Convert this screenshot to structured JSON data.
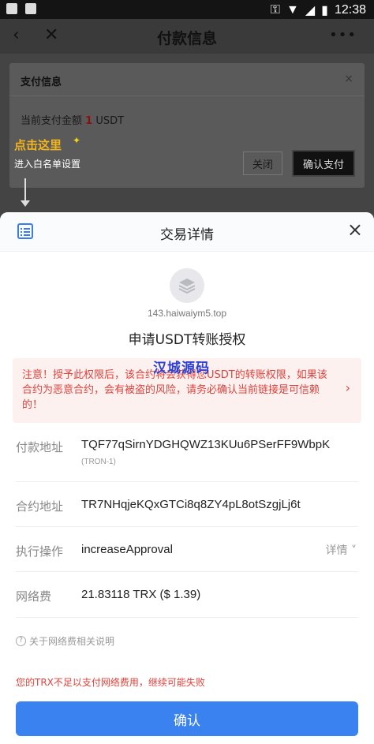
{
  "status_bar": {
    "time": "12:38"
  },
  "app_header": {
    "title": "付款信息",
    "back_icon": "back-arrow-icon",
    "close_icon": "close-icon",
    "more": "•••"
  },
  "pay_dialog": {
    "title": "支付信息",
    "close_glyph": "×",
    "amount_prefix": "当前支付金额 ",
    "amount_value": "1",
    "amount_unit": " USDT",
    "btn_close": "关闭",
    "btn_confirm": "确认支付"
  },
  "hint": {
    "click_here": "点击这里",
    "subtitle": "进入白名单设置"
  },
  "sheet": {
    "title": "交易详情",
    "close_glyph": "×",
    "domain": "143.haiwaiym5.top",
    "auth_title": "申请USDT转账授权",
    "warning": "注意！授予此权限后，该合约将会获得您USDT的转账权限，如果该合约为恶意合约，会有被盗的风险，请务必确认当前链接是可信赖的！",
    "watermark": "汉城源码",
    "rows": [
      {
        "label": "付款地址",
        "value": "TQF77qSirnYDGHQWZ13KUu6PSerFF9WbpK",
        "sub": "(TRON-1)"
      },
      {
        "label": "合约地址",
        "value": "TR7NHqjeKQxGTCi8q8ZY4pL8otSzgjLj6t"
      },
      {
        "label": "执行操作",
        "value": "increaseApproval",
        "detail": "详情 ˅"
      },
      {
        "label": "网络费",
        "value": "21.83118 TRX ($ 1.39)"
      }
    ],
    "fee_note": "关于网络费相关说明",
    "insufficient": "您的TRX不足以支付网络费用，继续可能失败",
    "confirm": "确认"
  },
  "colors": {
    "accent": "#3a82f0",
    "warning": "#e0423b",
    "hint": "#f2b41c"
  }
}
